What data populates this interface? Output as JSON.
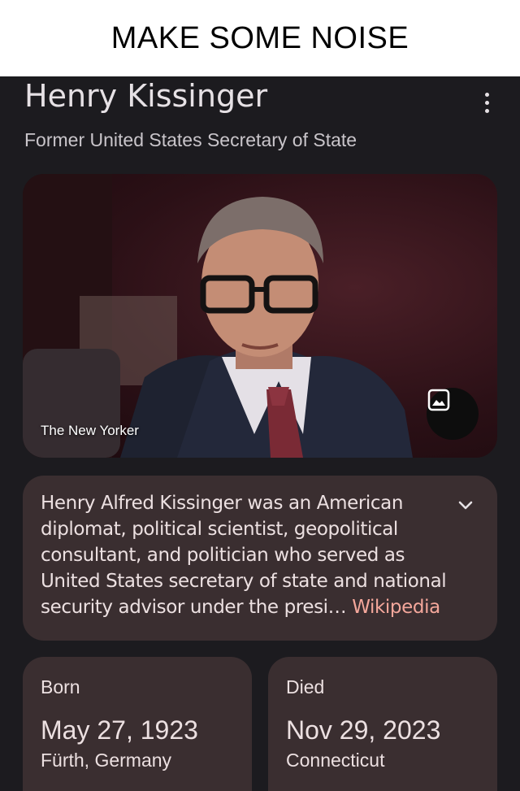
{
  "banner": {
    "text": "MAKE SOME NOISE"
  },
  "entity": {
    "name": "Henry Kissinger",
    "subtitle": "Former United States Secretary of State"
  },
  "image": {
    "caption": "The New Yorker",
    "button_icon": "image-icon"
  },
  "description": {
    "text": "Henry Alfred Kissinger was an American diplomat, political scientist, geopolitical consultant, and politician who served as United States secretary of state and national security advisor under the presi…",
    "source_link": "Wikipedia",
    "expand_icon": "chevron-down-icon"
  },
  "facts": {
    "born": {
      "label": "Born",
      "date": "May 27, 1923",
      "place": "Fürth, Germany"
    },
    "died": {
      "label": "Died",
      "date": "Nov 29, 2023",
      "place": "Connecticut"
    }
  },
  "colors": {
    "background": "#1c1b1f",
    "card": "#3a2e30",
    "link": "#f4a79b",
    "text": "#ece0e1"
  }
}
